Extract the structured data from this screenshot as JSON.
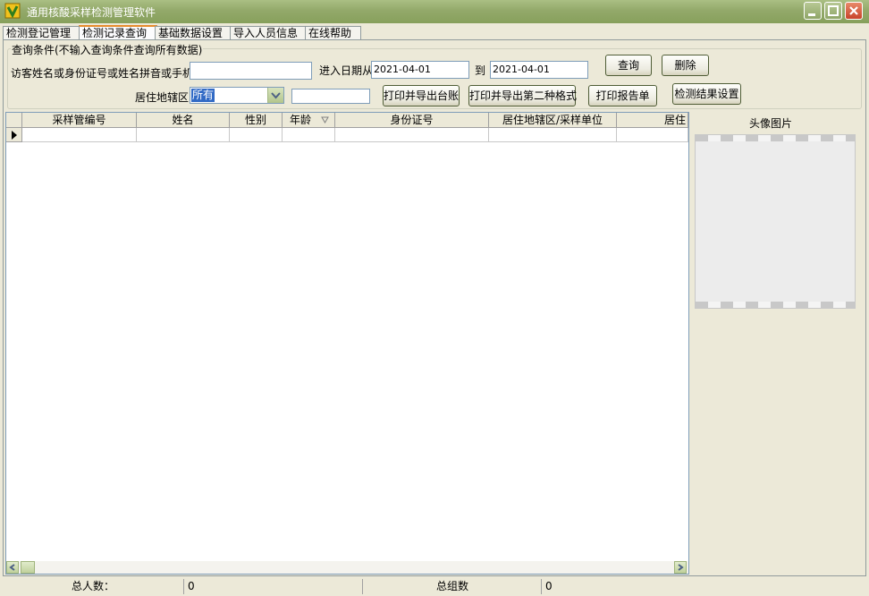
{
  "window": {
    "title": "通用核酸采样检测管理软件"
  },
  "tabs": [
    {
      "label": "检测登记管理"
    },
    {
      "label": "检测记录查询",
      "active": true
    },
    {
      "label": "基础数据设置"
    },
    {
      "label": "导入人员信息"
    },
    {
      "label": "在线帮助"
    }
  ],
  "query": {
    "legend": "查询条件(不输入查询条件查询所有数据)",
    "name_label": "访客姓名或身份证号或姓名拼音或手机",
    "name_value": "",
    "date_from_label": "进入日期从",
    "date_from": "2021-04-01",
    "date_to_label": "到",
    "date_to": "2021-04-01",
    "district_label": "居住地辖区",
    "district_value": "所有",
    "extra_value": "",
    "buttons": {
      "search": "查询",
      "delete": "删除",
      "print_ledger": "打印并导出台账",
      "print_format2": "打印并导出第二种格式",
      "print_report": "打印报告单",
      "result_settings": "检测结果设置"
    }
  },
  "grid": {
    "columns": [
      "采样管编号",
      "姓名",
      "性别",
      "年龄",
      "身份证号",
      "居住地辖区/采样单位",
      "居住"
    ],
    "sorted_column": "年龄",
    "rows": []
  },
  "photo": {
    "title": "头像图片"
  },
  "status": {
    "total_people_label": "总人数：",
    "total_people_value": "0",
    "total_groups_label": "总组数",
    "total_groups_value": "0"
  },
  "colors": {
    "titlebar": "#93a96a",
    "tab_active_accent": "#e68b2c",
    "selection": "#316ac5"
  }
}
